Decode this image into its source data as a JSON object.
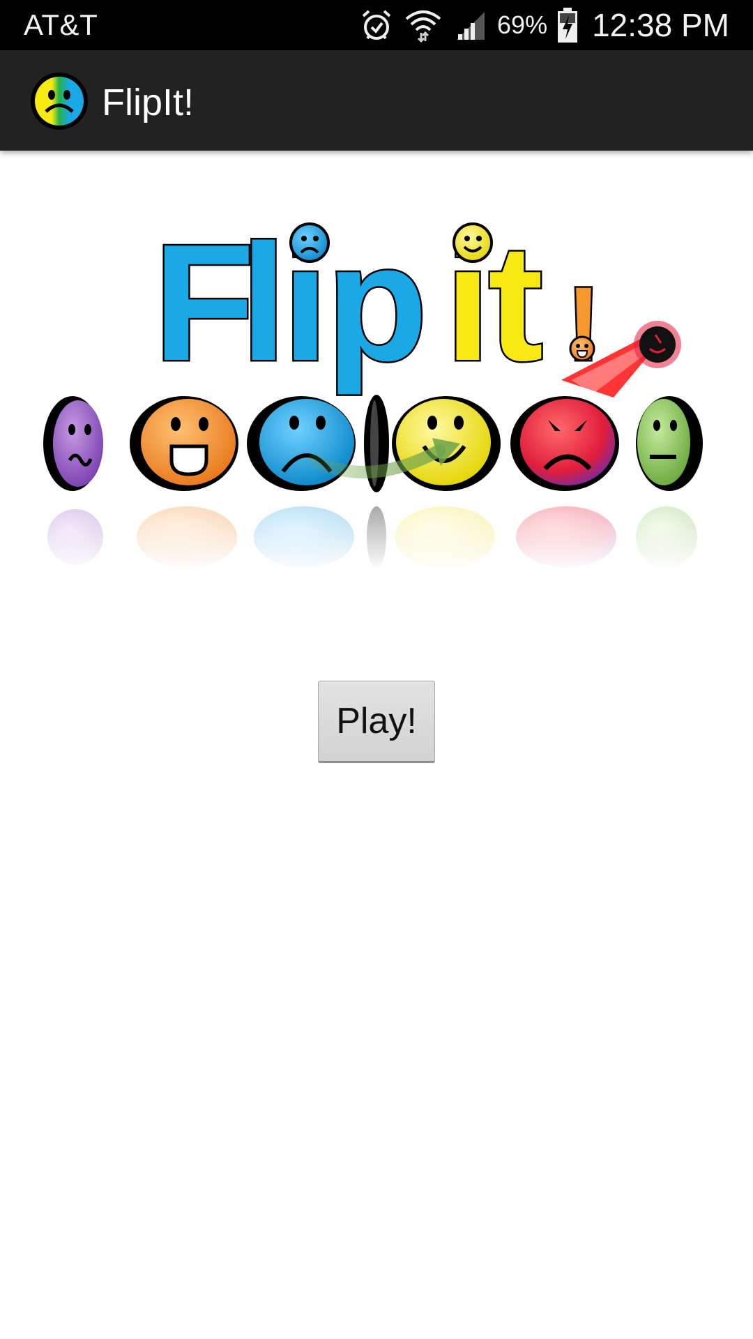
{
  "status_bar": {
    "carrier": "AT&T",
    "battery_percent": "69%",
    "time": "12:38 PM",
    "icons": [
      "alarm-icon",
      "wifi-icon",
      "signal-icon",
      "battery-charging-icon"
    ]
  },
  "action_bar": {
    "title": "FlipIt!",
    "icon": "flipit-app-icon"
  },
  "logo": {
    "text_letters": [
      "F",
      "l",
      "i",
      "p",
      "i",
      "t",
      "!"
    ],
    "colors": {
      "blue": "#1ba8e6",
      "yellow": "#f6ea12",
      "orange": "#f7982e",
      "purple": "#9b5bc9",
      "red": "#e8344a",
      "green": "#8bc55c"
    },
    "faces": [
      "confused-face-icon",
      "laughing-face-icon",
      "sad-face-icon",
      "flipping-coin-icon",
      "happy-face-icon",
      "angry-face-icon",
      "neutral-face-icon"
    ]
  },
  "main": {
    "play_label": "Play!"
  }
}
